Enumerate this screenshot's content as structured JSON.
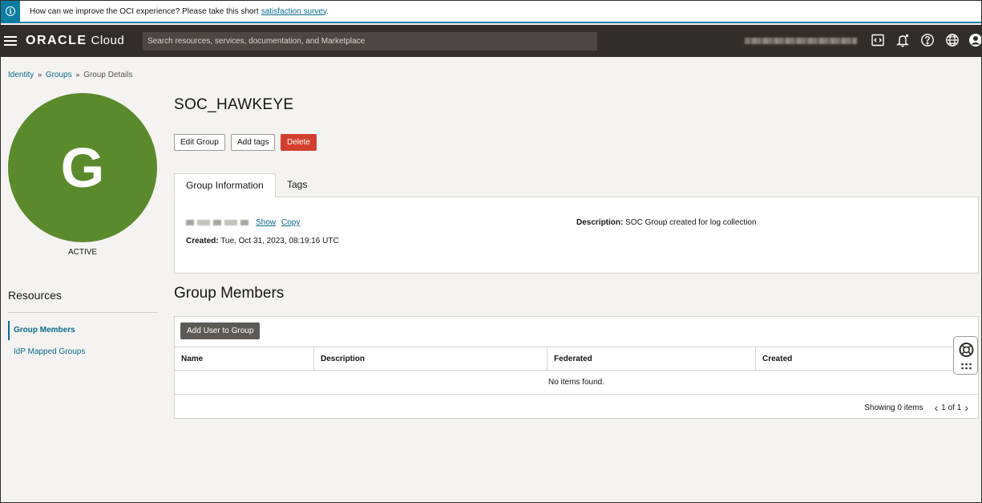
{
  "banner": {
    "text": "How can we improve the OCI experience? Please take this short",
    "link": "satisfaction survey",
    "suffix": "."
  },
  "header": {
    "logo_bold": "ORACLE",
    "logo_light": "Cloud",
    "search_placeholder": "Search resources, services, documentation, and Marketplace"
  },
  "breadcrumb": {
    "items": [
      "Identity",
      "Groups",
      "Group Details"
    ],
    "separator": "»"
  },
  "group": {
    "avatar_letter": "G",
    "avatar_color": "#5b8a2d",
    "status": "ACTIVE",
    "name": "SOC_HAWKEYE"
  },
  "actions": {
    "edit": "Edit Group",
    "tags": "Add tags",
    "delete": "Delete"
  },
  "tabs": [
    {
      "label": "Group Information",
      "active": true
    },
    {
      "label": "Tags",
      "active": false
    }
  ],
  "info": {
    "show": "Show",
    "copy": "Copy",
    "created_label": "Created:",
    "created_value": "Tue, Oct 31, 2023, 08:19:16 UTC",
    "description_label": "Description:",
    "description_value": "SOC Group created for log collection"
  },
  "resources": {
    "title": "Resources",
    "items": [
      {
        "label": "Group Members",
        "active": true
      },
      {
        "label": "IdP Mapped Groups",
        "active": false
      }
    ]
  },
  "members": {
    "title": "Group Members",
    "add_button": "Add User to Group",
    "columns": [
      "Name",
      "Description",
      "Federated",
      "Created"
    ],
    "empty_text": "No items found.",
    "showing": "Showing 0 items",
    "page": "1 of 1"
  },
  "colors": {
    "accent": "#0a6a8c",
    "header_bg": "#312d2a",
    "danger": "#d33f2f"
  }
}
